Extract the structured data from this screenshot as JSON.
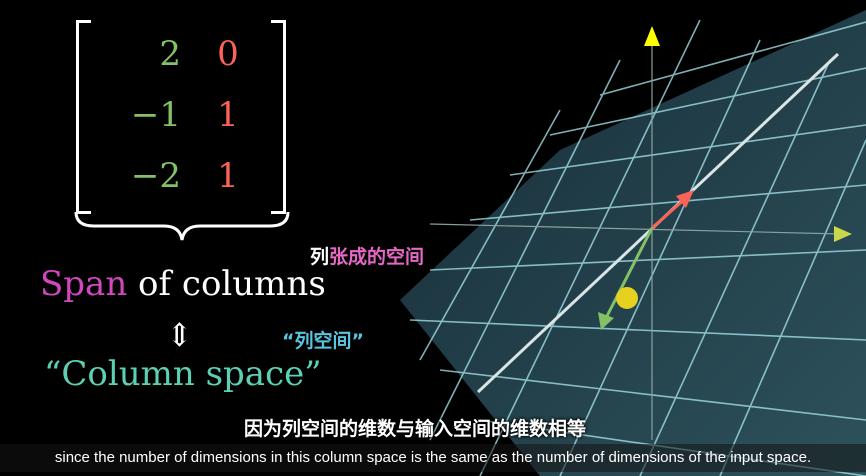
{
  "matrix": {
    "column_1": [
      "2",
      "−1",
      "−2"
    ],
    "column_2": [
      "0",
      "1",
      "1"
    ]
  },
  "labels": {
    "zh_span_prefix": "列",
    "zh_span_rest": "张成的空间",
    "span_word": "Span",
    "span_rest": " of columns",
    "equivalence_symbol": "⇕",
    "zh_column_space": "“列空间”",
    "column_space": "“Column space”"
  },
  "subtitles": {
    "zh": "因为列空间的维数与输入空间的维数相等",
    "en": "since the number of dimensions in this column space is the same as the number of dimensions of the input space."
  },
  "colors": {
    "first_column": "#83c167",
    "second_column": "#fc6255",
    "span_word": "#d147bd",
    "column_space": "#5cd0b3",
    "zh_column_space": "#58c4dd",
    "grid": "#a9e8f0",
    "plane": "#2a4c58",
    "axis_up": "#ffff00",
    "axis_right": "#c8d84a"
  },
  "icons": {
    "updown": "double-up-down-arrow",
    "brace": "curly-underbrace"
  }
}
